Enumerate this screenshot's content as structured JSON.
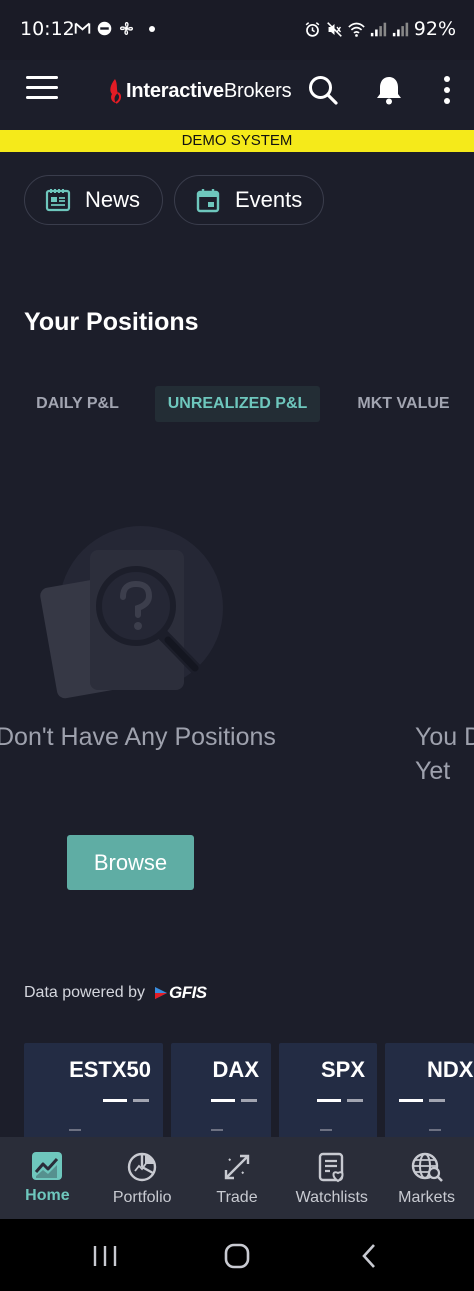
{
  "status_bar": {
    "time": "10:12",
    "battery": "92%"
  },
  "header": {
    "logo_bold": "Interactive",
    "logo_light": "Brokers",
    "menu_icon": "hamburger-icon",
    "search_icon": "search-icon",
    "bell_icon": "bell-icon",
    "more_icon": "more-vertical-icon"
  },
  "banner": {
    "text": "DEMO SYSTEM",
    "color": "#f5ea1a"
  },
  "chips": [
    {
      "label": "News",
      "icon": "news-icon"
    },
    {
      "label": "Events",
      "icon": "calendar-icon"
    }
  ],
  "positions": {
    "title": "Your Positions",
    "tabs": [
      {
        "label": "DAILY P&L",
        "active": false
      },
      {
        "label": "UNREALIZED P&L",
        "active": true
      },
      {
        "label": "MKT VALUE",
        "active": false
      }
    ],
    "empty_text_left": "Don't Have Any Positions",
    "empty_text_right_1": "You D",
    "empty_text_right_2": "Yet",
    "browse_label": "Browse"
  },
  "powered_by": {
    "text": "Data powered by",
    "brand": "GFIS"
  },
  "tickers": [
    {
      "name": "ESTX50"
    },
    {
      "name": "DAX"
    },
    {
      "name": "SPX"
    },
    {
      "name": "NDX"
    }
  ],
  "bottom_nav": [
    {
      "label": "Home",
      "icon": "home-chart-icon",
      "active": true
    },
    {
      "label": "Portfolio",
      "icon": "pie-chart-icon",
      "active": false
    },
    {
      "label": "Trade",
      "icon": "trade-arrows-icon",
      "active": false
    },
    {
      "label": "Watchlists",
      "icon": "watchlist-icon",
      "active": false
    },
    {
      "label": "Markets",
      "icon": "globe-search-icon",
      "active": false
    }
  ],
  "colors": {
    "accent": "#6ec7bd",
    "background": "#1c1e2a",
    "button": "#5fada4"
  }
}
